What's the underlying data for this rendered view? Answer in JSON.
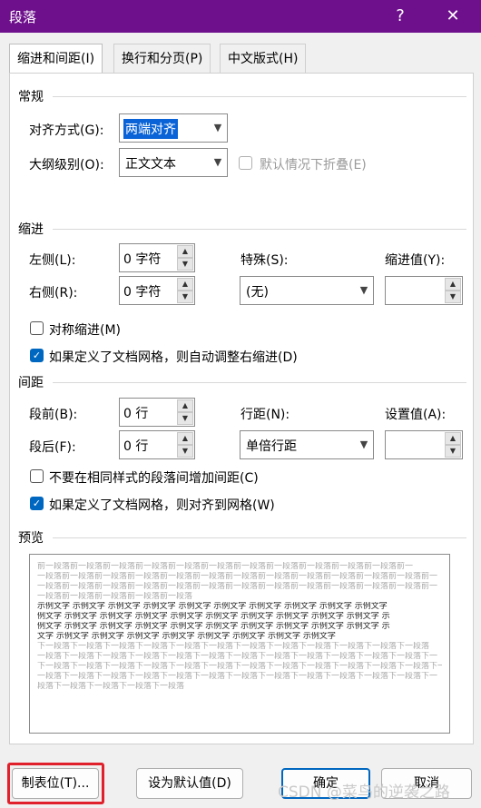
{
  "window": {
    "title": "段落",
    "help_label": "?",
    "close_label": "✕"
  },
  "tabs": [
    {
      "label": "缩进和间距(I)"
    },
    {
      "label": "换行和分页(P)"
    },
    {
      "label": "中文版式(H)"
    }
  ],
  "general": {
    "heading": "常规",
    "alignment_label": "对齐方式(G):",
    "alignment_value": "两端对齐",
    "outline_label": "大纲级别(O):",
    "outline_value": "正文文本",
    "collapse_label": "默认情况下折叠(E)"
  },
  "indent": {
    "heading": "缩进",
    "left_label": "左侧(L):",
    "left_value": "0 字符",
    "right_label": "右侧(R):",
    "right_value": "0 字符",
    "special_label": "特殊(S):",
    "special_value": "(无)",
    "by_label": "缩进值(Y):",
    "by_value": "",
    "mirror_label": "对称缩进(M)",
    "mirror_checked": false,
    "auto_adjust_label": "如果定义了文档网格，则自动调整右缩进(D)",
    "auto_adjust_checked": true
  },
  "spacing": {
    "heading": "间距",
    "before_label": "段前(B):",
    "before_value": "0 行",
    "after_label": "段后(F):",
    "after_value": "0 行",
    "line_label": "行距(N):",
    "line_value": "单倍行距",
    "at_label": "设置值(A):",
    "at_value": "",
    "no_space_label": "不要在相同样式的段落间增加间距(C)",
    "no_space_checked": false,
    "snap_label": "如果定义了文档网格，则对齐到网格(W)",
    "snap_checked": true
  },
  "preview": {
    "heading": "预览",
    "lines": [
      {
        "text": "前一段落前一段落前一段落前一段落前一段落前一段落前一段落前一段落前一段落前一段落前一段落前一",
        "tone": "gray"
      },
      {
        "text": "一段落前一段落前一段落前一段落前一段落前一段落前一段落前一段落前一段落前一段落前一段落前一段落前一",
        "tone": "gray"
      },
      {
        "text": "一段落前一段落前一段落前一段落前一段落前一段落前一段落前一段落前一段落前一段落前一段落前一段落前一",
        "tone": "gray"
      },
      {
        "text": "一段落前一段落前一段落前一段落前一段落",
        "tone": "gray"
      },
      {
        "text": "示例文字  示例文字  示例文字  示例文字  示例文字  示例文字  示例文字  示例文字  示例文字  示例文字",
        "tone": "black"
      },
      {
        "text": "例文字  示例文字  示例文字  示例文字  示例文字  示例文字  示例文字  示例文字  示例文字  示例文字  示",
        "tone": "black"
      },
      {
        "text": "例文字  示例文字  示例文字  示例文字  示例文字  示例文字  示例文字  示例文字  示例文字  示例文字  示",
        "tone": "black"
      },
      {
        "text": "文字  示例文字  示例文字  示例文字  示例文字  示例文字  示例文字  示例文字  示例文字",
        "tone": "black"
      },
      {
        "text": "下一段落下一段落下一段落下一段落下一段落下一段落下一段落下一段落下一段落下一段落下一段落下一段落",
        "tone": "gray"
      },
      {
        "text": "一段落下一段落下一段落下一段落下一段落下一段落下一段落下一段落下一段落下一段落下一段落下一段落下一",
        "tone": "gray"
      },
      {
        "text": "下一段落下一段落下一段落下一段落下一段落下一段落下一段落下一段落下一段落下一段落下一段落下一段落下一",
        "tone": "gray"
      },
      {
        "text": "一段落下一段落下一段落下一段落下一段落下一段落下一段落下一段落下一段落下一段落下一段落下一段落下一",
        "tone": "gray"
      },
      {
        "text": "段落下一段落下一段落下一段落下一段落",
        "tone": "gray"
      }
    ]
  },
  "buttons": {
    "tabs_label": "制表位(T)...",
    "default_label": "设为默认值(D)",
    "ok_label": "确定",
    "cancel_label": "取消"
  },
  "watermark": "CSDN @菜鸟的逆袭之路",
  "colors": {
    "titlebar": "#6e0f8c",
    "accent": "#0067c0",
    "highlight_box": "#e0202a"
  }
}
